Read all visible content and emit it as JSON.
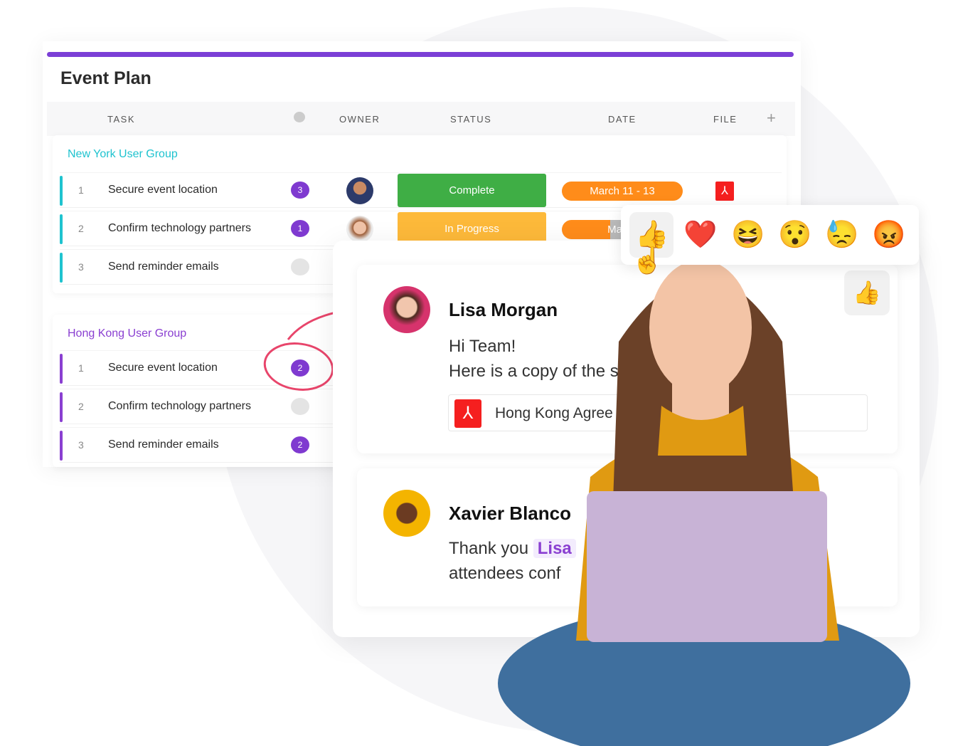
{
  "title": "Event Plan",
  "columns": {
    "task": "TASK",
    "owner": "OWNER",
    "status": "STATUS",
    "date": "DATE",
    "file": "FILE",
    "add": "+"
  },
  "groups": [
    {
      "name": "New York User Group",
      "color": "#1fc3cf",
      "rows": [
        {
          "num": "1",
          "task": "Secure event location",
          "comments": "3",
          "status": "Complete",
          "date": "March 11 - 13",
          "has_file": true
        },
        {
          "num": "2",
          "task": "Confirm technology partners",
          "comments": "1",
          "status": "In Progress",
          "date": "March"
        },
        {
          "num": "3",
          "task": "Send reminder emails",
          "comments": ""
        }
      ]
    },
    {
      "name": "Hong Kong User Group",
      "color": "#8a3fd1",
      "rows": [
        {
          "num": "1",
          "task": "Secure event location",
          "comments": "2"
        },
        {
          "num": "2",
          "task": "Confirm technology partners",
          "comments": ""
        },
        {
          "num": "3",
          "task": "Send reminder emails",
          "comments": "2"
        }
      ]
    }
  ],
  "status_colors": {
    "Complete": "#3fae45",
    "In Progress": "#fdb93a"
  },
  "comments": [
    {
      "author": "Lisa Morgan",
      "line1": "Hi Team!",
      "line2": "Here is a copy of the sig",
      "attachment": "Hong Kong Agree"
    },
    {
      "author": "Xavier Blanco",
      "line1_prefix": "Thank you",
      "mention": "Lisa",
      "line2": "attendees conf"
    }
  ],
  "reactions": [
    "👍",
    "❤️",
    "😆",
    "😯",
    "😓",
    "😡"
  ],
  "like_icon": "thumbs-up-icon"
}
